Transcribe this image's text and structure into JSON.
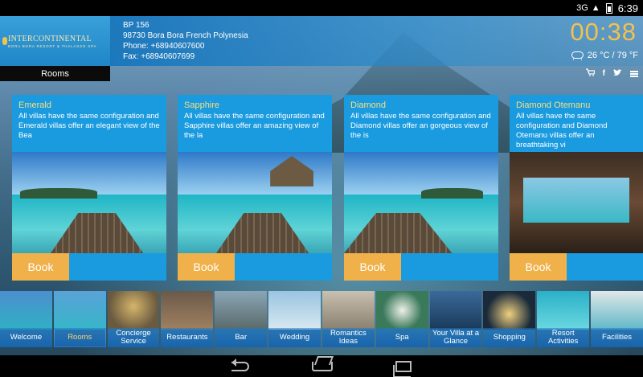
{
  "status_bar": {
    "signal": "3G",
    "time": "6:39"
  },
  "brand": {
    "name": "INTERCONTINENTAL",
    "tagline": "BORA BORA RESORT & THALASSO SPA"
  },
  "contact": {
    "line1": "BP 156",
    "line2": "98730 Bora Bora French Polynesia",
    "phone": "Phone: +68940607600",
    "fax": "Fax: +68940607699"
  },
  "clock": "00:38",
  "weather": {
    "text": "26 °C / 79 °F",
    "icon": "cloud-rain-icon"
  },
  "section_tab": "Rooms",
  "social": {
    "cart": "cart-icon",
    "facebook": "f",
    "twitter": "twitter-icon",
    "menu": "menu-icon"
  },
  "rooms": [
    {
      "title": "Emerald",
      "desc": "All villas have the same configuration and Emerald villas offer an elegant view of the Bea",
      "book": "Book"
    },
    {
      "title": "Sapphire",
      "desc": "All villas have the same configuration and Sapphire villas offer an amazing view of the la",
      "book": "Book"
    },
    {
      "title": "Diamond",
      "desc": "All villas have the same configuration and Diamond villas offer an gorgeous view of the is",
      "book": "Book"
    },
    {
      "title": "Diamond Otemanu",
      "desc": "All villas have the same configuration and Diamond Otemanu villas offer an breathtaking vi",
      "book": "Book"
    }
  ],
  "nav": [
    {
      "label": "Welcome"
    },
    {
      "label": "Rooms"
    },
    {
      "label": "Concierge Service"
    },
    {
      "label": "Restaurants"
    },
    {
      "label": "Bar"
    },
    {
      "label": "Wedding"
    },
    {
      "label": "Romantics Ideas"
    },
    {
      "label": "Spa"
    },
    {
      "label": "Your Villa at a Glance"
    },
    {
      "label": "Shopping"
    },
    {
      "label": "Resort Activities"
    },
    {
      "label": "Facilities"
    }
  ],
  "active_nav": "Rooms",
  "colors": {
    "accent": "#f0b14a",
    "primary": "#1a9be0",
    "clock": "#f2c14e"
  }
}
